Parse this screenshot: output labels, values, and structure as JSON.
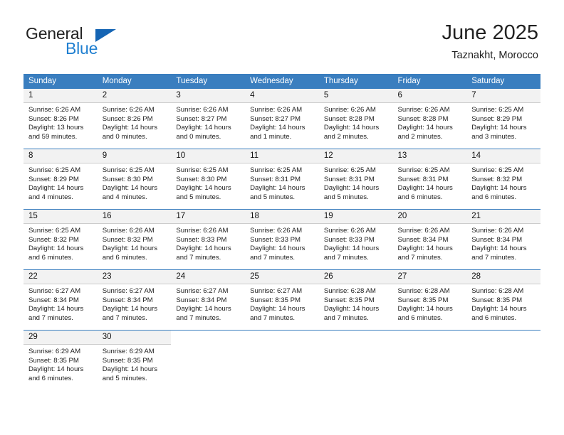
{
  "brand": {
    "line1": "General",
    "line2": "Blue",
    "triangle_color": "#1565b4",
    "blue_text_color": "#1f7fd0"
  },
  "header": {
    "title": "June 2025",
    "subtitle": "Taznakht, Morocco"
  },
  "theme": {
    "header_bg": "#3a7ebf",
    "header_text": "#ffffff",
    "daynum_bg": "#f2f2f2",
    "grid_line": "#3a7ebf",
    "daynum_border": "#cccccc",
    "body_text": "#222222"
  },
  "columns": [
    "Sunday",
    "Monday",
    "Tuesday",
    "Wednesday",
    "Thursday",
    "Friday",
    "Saturday"
  ],
  "weeks": [
    [
      {
        "day": "1",
        "sunrise": "Sunrise: 6:26 AM",
        "sunset": "Sunset: 8:26 PM",
        "daylight_1": "Daylight: 13 hours",
        "daylight_2": "and 59 minutes."
      },
      {
        "day": "2",
        "sunrise": "Sunrise: 6:26 AM",
        "sunset": "Sunset: 8:26 PM",
        "daylight_1": "Daylight: 14 hours",
        "daylight_2": "and 0 minutes."
      },
      {
        "day": "3",
        "sunrise": "Sunrise: 6:26 AM",
        "sunset": "Sunset: 8:27 PM",
        "daylight_1": "Daylight: 14 hours",
        "daylight_2": "and 0 minutes."
      },
      {
        "day": "4",
        "sunrise": "Sunrise: 6:26 AM",
        "sunset": "Sunset: 8:27 PM",
        "daylight_1": "Daylight: 14 hours",
        "daylight_2": "and 1 minute."
      },
      {
        "day": "5",
        "sunrise": "Sunrise: 6:26 AM",
        "sunset": "Sunset: 8:28 PM",
        "daylight_1": "Daylight: 14 hours",
        "daylight_2": "and 2 minutes."
      },
      {
        "day": "6",
        "sunrise": "Sunrise: 6:26 AM",
        "sunset": "Sunset: 8:28 PM",
        "daylight_1": "Daylight: 14 hours",
        "daylight_2": "and 2 minutes."
      },
      {
        "day": "7",
        "sunrise": "Sunrise: 6:25 AM",
        "sunset": "Sunset: 8:29 PM",
        "daylight_1": "Daylight: 14 hours",
        "daylight_2": "and 3 minutes."
      }
    ],
    [
      {
        "day": "8",
        "sunrise": "Sunrise: 6:25 AM",
        "sunset": "Sunset: 8:29 PM",
        "daylight_1": "Daylight: 14 hours",
        "daylight_2": "and 4 minutes."
      },
      {
        "day": "9",
        "sunrise": "Sunrise: 6:25 AM",
        "sunset": "Sunset: 8:30 PM",
        "daylight_1": "Daylight: 14 hours",
        "daylight_2": "and 4 minutes."
      },
      {
        "day": "10",
        "sunrise": "Sunrise: 6:25 AM",
        "sunset": "Sunset: 8:30 PM",
        "daylight_1": "Daylight: 14 hours",
        "daylight_2": "and 5 minutes."
      },
      {
        "day": "11",
        "sunrise": "Sunrise: 6:25 AM",
        "sunset": "Sunset: 8:31 PM",
        "daylight_1": "Daylight: 14 hours",
        "daylight_2": "and 5 minutes."
      },
      {
        "day": "12",
        "sunrise": "Sunrise: 6:25 AM",
        "sunset": "Sunset: 8:31 PM",
        "daylight_1": "Daylight: 14 hours",
        "daylight_2": "and 5 minutes."
      },
      {
        "day": "13",
        "sunrise": "Sunrise: 6:25 AM",
        "sunset": "Sunset: 8:31 PM",
        "daylight_1": "Daylight: 14 hours",
        "daylight_2": "and 6 minutes."
      },
      {
        "day": "14",
        "sunrise": "Sunrise: 6:25 AM",
        "sunset": "Sunset: 8:32 PM",
        "daylight_1": "Daylight: 14 hours",
        "daylight_2": "and 6 minutes."
      }
    ],
    [
      {
        "day": "15",
        "sunrise": "Sunrise: 6:25 AM",
        "sunset": "Sunset: 8:32 PM",
        "daylight_1": "Daylight: 14 hours",
        "daylight_2": "and 6 minutes."
      },
      {
        "day": "16",
        "sunrise": "Sunrise: 6:26 AM",
        "sunset": "Sunset: 8:32 PM",
        "daylight_1": "Daylight: 14 hours",
        "daylight_2": "and 6 minutes."
      },
      {
        "day": "17",
        "sunrise": "Sunrise: 6:26 AM",
        "sunset": "Sunset: 8:33 PM",
        "daylight_1": "Daylight: 14 hours",
        "daylight_2": "and 7 minutes."
      },
      {
        "day": "18",
        "sunrise": "Sunrise: 6:26 AM",
        "sunset": "Sunset: 8:33 PM",
        "daylight_1": "Daylight: 14 hours",
        "daylight_2": "and 7 minutes."
      },
      {
        "day": "19",
        "sunrise": "Sunrise: 6:26 AM",
        "sunset": "Sunset: 8:33 PM",
        "daylight_1": "Daylight: 14 hours",
        "daylight_2": "and 7 minutes."
      },
      {
        "day": "20",
        "sunrise": "Sunrise: 6:26 AM",
        "sunset": "Sunset: 8:34 PM",
        "daylight_1": "Daylight: 14 hours",
        "daylight_2": "and 7 minutes."
      },
      {
        "day": "21",
        "sunrise": "Sunrise: 6:26 AM",
        "sunset": "Sunset: 8:34 PM",
        "daylight_1": "Daylight: 14 hours",
        "daylight_2": "and 7 minutes."
      }
    ],
    [
      {
        "day": "22",
        "sunrise": "Sunrise: 6:27 AM",
        "sunset": "Sunset: 8:34 PM",
        "daylight_1": "Daylight: 14 hours",
        "daylight_2": "and 7 minutes."
      },
      {
        "day": "23",
        "sunrise": "Sunrise: 6:27 AM",
        "sunset": "Sunset: 8:34 PM",
        "daylight_1": "Daylight: 14 hours",
        "daylight_2": "and 7 minutes."
      },
      {
        "day": "24",
        "sunrise": "Sunrise: 6:27 AM",
        "sunset": "Sunset: 8:34 PM",
        "daylight_1": "Daylight: 14 hours",
        "daylight_2": "and 7 minutes."
      },
      {
        "day": "25",
        "sunrise": "Sunrise: 6:27 AM",
        "sunset": "Sunset: 8:35 PM",
        "daylight_1": "Daylight: 14 hours",
        "daylight_2": "and 7 minutes."
      },
      {
        "day": "26",
        "sunrise": "Sunrise: 6:28 AM",
        "sunset": "Sunset: 8:35 PM",
        "daylight_1": "Daylight: 14 hours",
        "daylight_2": "and 7 minutes."
      },
      {
        "day": "27",
        "sunrise": "Sunrise: 6:28 AM",
        "sunset": "Sunset: 8:35 PM",
        "daylight_1": "Daylight: 14 hours",
        "daylight_2": "and 6 minutes."
      },
      {
        "day": "28",
        "sunrise": "Sunrise: 6:28 AM",
        "sunset": "Sunset: 8:35 PM",
        "daylight_1": "Daylight: 14 hours",
        "daylight_2": "and 6 minutes."
      }
    ],
    [
      {
        "day": "29",
        "sunrise": "Sunrise: 6:29 AM",
        "sunset": "Sunset: 8:35 PM",
        "daylight_1": "Daylight: 14 hours",
        "daylight_2": "and 6 minutes."
      },
      {
        "day": "30",
        "sunrise": "Sunrise: 6:29 AM",
        "sunset": "Sunset: 8:35 PM",
        "daylight_1": "Daylight: 14 hours",
        "daylight_2": "and 5 minutes."
      },
      {
        "day": "",
        "sunrise": "",
        "sunset": "",
        "daylight_1": "",
        "daylight_2": ""
      },
      {
        "day": "",
        "sunrise": "",
        "sunset": "",
        "daylight_1": "",
        "daylight_2": ""
      },
      {
        "day": "",
        "sunrise": "",
        "sunset": "",
        "daylight_1": "",
        "daylight_2": ""
      },
      {
        "day": "",
        "sunrise": "",
        "sunset": "",
        "daylight_1": "",
        "daylight_2": ""
      },
      {
        "day": "",
        "sunrise": "",
        "sunset": "",
        "daylight_1": "",
        "daylight_2": ""
      }
    ]
  ]
}
